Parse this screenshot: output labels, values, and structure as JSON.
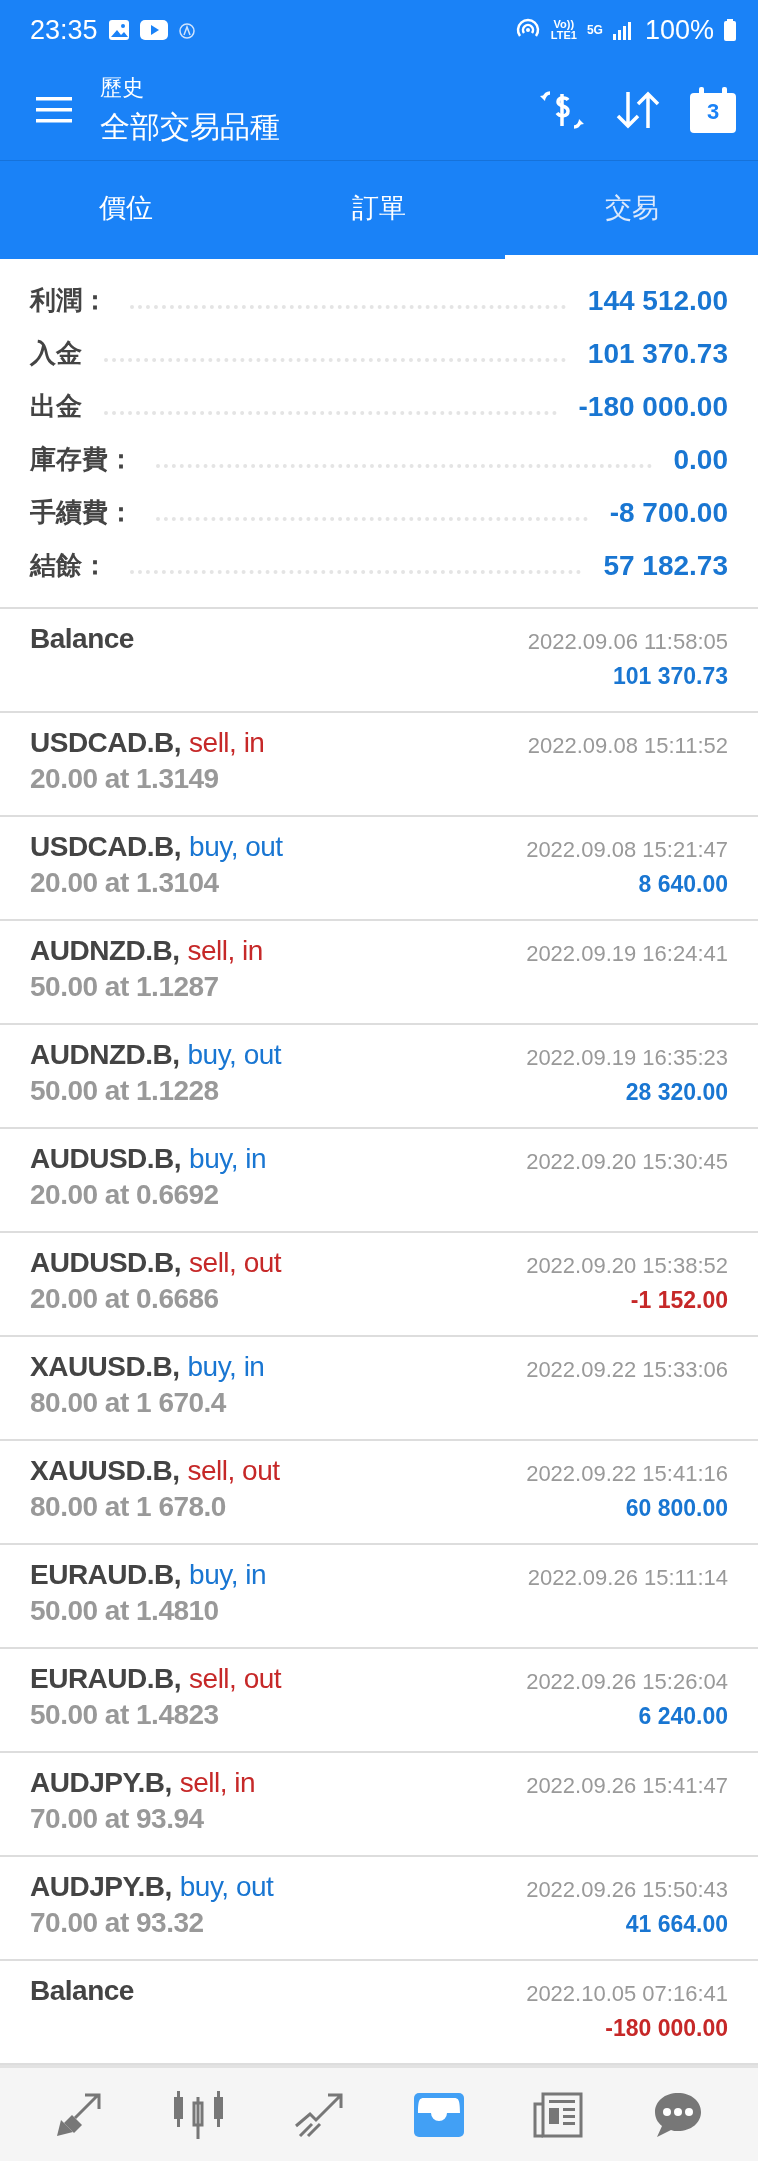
{
  "status_bar": {
    "time": "23:35",
    "volte": [
      "Vo))",
      "LTE1"
    ],
    "network": "5G",
    "battery": "100%"
  },
  "header": {
    "subtitle": "歷史",
    "title": "全部交易品種",
    "calendar_day": "3"
  },
  "tabs": [
    {
      "label": "價位",
      "selected": false
    },
    {
      "label": "訂單",
      "selected": false
    },
    {
      "label": "交易",
      "selected": true
    }
  ],
  "summary": [
    {
      "label": "利潤：",
      "value": "144 512.00"
    },
    {
      "label": "入金",
      "value": "101 370.73"
    },
    {
      "label": "出金",
      "value": "-180 000.00"
    },
    {
      "label": "庫存費：",
      "value": "0.00"
    },
    {
      "label": "手續費：",
      "value": "-8 700.00"
    },
    {
      "label": "結餘：",
      "value": "57 182.73"
    }
  ],
  "deals": [
    {
      "kind": "balance",
      "symbol": "Balance",
      "time": "2022.09.06 11:58:05",
      "profit": "101 370.73",
      "negative": false
    },
    {
      "kind": "deal",
      "symbol": "USDCAD.B,",
      "color": "#c62828",
      "action": "sell, in",
      "detail": "20.00 at 1.3149",
      "time": "2022.09.08 15:11:52"
    },
    {
      "kind": "deal",
      "symbol": "USDCAD.B,",
      "color": "#1976d2",
      "action": "buy, out",
      "detail": "20.00 at 1.3104",
      "time": "2022.09.08 15:21:47",
      "profit": "8 640.00",
      "negative": false
    },
    {
      "kind": "deal",
      "symbol": "AUDNZD.B,",
      "color": "#c62828",
      "action": "sell, in",
      "detail": "50.00 at 1.1287",
      "time": "2022.09.19 16:24:41"
    },
    {
      "kind": "deal",
      "symbol": "AUDNZD.B,",
      "color": "#1976d2",
      "action": "buy, out",
      "detail": "50.00 at 1.1228",
      "time": "2022.09.19 16:35:23",
      "profit": "28 320.00",
      "negative": false
    },
    {
      "kind": "deal",
      "symbol": "AUDUSD.B,",
      "color": "#1976d2",
      "action": "buy, in",
      "detail": "20.00 at 0.6692",
      "time": "2022.09.20 15:30:45"
    },
    {
      "kind": "deal",
      "symbol": "AUDUSD.B,",
      "color": "#c62828",
      "action": "sell, out",
      "detail": "20.00 at 0.6686",
      "time": "2022.09.20 15:38:52",
      "profit": "-1 152.00",
      "negative": true
    },
    {
      "kind": "deal",
      "symbol": "XAUUSD.B,",
      "color": "#1976d2",
      "action": "buy, in",
      "detail": "80.00 at 1 670.4",
      "time": "2022.09.22 15:33:06"
    },
    {
      "kind": "deal",
      "symbol": "XAUUSD.B,",
      "color": "#c62828",
      "action": "sell, out",
      "detail": "80.00 at 1 678.0",
      "time": "2022.09.22 15:41:16",
      "profit": "60 800.00",
      "negative": false
    },
    {
      "kind": "deal",
      "symbol": "EURAUD.B,",
      "color": "#1976d2",
      "action": "buy, in",
      "detail": "50.00 at 1.4810",
      "time": "2022.09.26 15:11:14"
    },
    {
      "kind": "deal",
      "symbol": "EURAUD.B,",
      "color": "#c62828",
      "action": "sell, out",
      "detail": "50.00 at 1.4823",
      "time": "2022.09.26 15:26:04",
      "profit": "6 240.00",
      "negative": false
    },
    {
      "kind": "deal",
      "symbol": "AUDJPY.B,",
      "color": "#c62828",
      "action": "sell, in",
      "detail": "70.00 at 93.94",
      "time": "2022.09.26 15:41:47"
    },
    {
      "kind": "deal",
      "symbol": "AUDJPY.B,",
      "color": "#1976d2",
      "action": "buy, out",
      "detail": "70.00 at 93.32",
      "time": "2022.09.26 15:50:43",
      "profit": "41 664.00",
      "negative": false
    },
    {
      "kind": "balance",
      "symbol": "Balance",
      "time": "2022.10.05 07:16:41",
      "profit": "-180 000.00",
      "negative": true
    }
  ],
  "nav": [
    {
      "selected": false
    },
    {
      "selected": false
    },
    {
      "selected": false
    },
    {
      "selected": true
    },
    {
      "selected": false
    },
    {
      "selected": false
    }
  ]
}
